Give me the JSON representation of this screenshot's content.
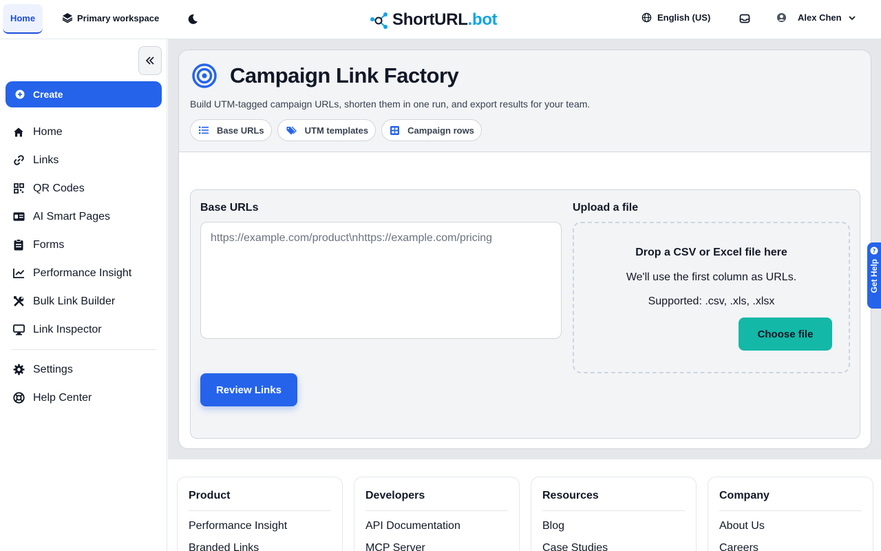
{
  "topbar": {
    "home_tab": "Home",
    "workspace": "Primary workspace",
    "logo_main": "ShortURL",
    "logo_accent": ".bot",
    "language": "English (US)",
    "user_name": "Alex Chen"
  },
  "sidebar": {
    "create_label": "Create",
    "items": [
      {
        "label": "Home",
        "icon": "home-icon"
      },
      {
        "label": "Links",
        "icon": "link-icon"
      },
      {
        "label": "QR Codes",
        "icon": "qr-icon"
      },
      {
        "label": "AI Smart Pages",
        "icon": "id-card-icon"
      },
      {
        "label": "Forms",
        "icon": "clipboard-icon"
      },
      {
        "label": "Performance Insight",
        "icon": "chart-line-icon"
      },
      {
        "label": "Bulk Link Builder",
        "icon": "tools-icon"
      },
      {
        "label": "Link Inspector",
        "icon": "monitor-icon"
      }
    ],
    "secondary": [
      {
        "label": "Settings",
        "icon": "gear-icon"
      },
      {
        "label": "Help Center",
        "icon": "lifebuoy-icon"
      }
    ]
  },
  "page": {
    "title": "Campaign Link Factory",
    "subtitle": "Build UTM-tagged campaign URLs, shorten them in one run, and export results for your team.",
    "pills": [
      {
        "label": "Base URLs",
        "icon": "list-icon"
      },
      {
        "label": "UTM templates",
        "icon": "tag-icon"
      },
      {
        "label": "Campaign rows",
        "icon": "table-icon"
      }
    ]
  },
  "form": {
    "base_urls_label": "Base URLs",
    "base_urls_placeholder": "https://example.com/product\\nhttps://example.com/pricing",
    "review_button": "Review Links",
    "upload_label": "Upload a file",
    "drop_title": "Drop a CSV or Excel file here",
    "drop_hint": "We'll use the first column as URLs.",
    "supported": "Supported: .csv, .xls, .xlsx",
    "choose_button": "Choose file"
  },
  "footer": {
    "columns": [
      {
        "title": "Product",
        "links": [
          "Performance Insight",
          "Branded Links"
        ]
      },
      {
        "title": "Developers",
        "links": [
          "API Documentation",
          "MCP Server"
        ]
      },
      {
        "title": "Resources",
        "links": [
          "Blog",
          "Case Studies"
        ]
      },
      {
        "title": "Company",
        "links": [
          "About Us",
          "Careers"
        ]
      }
    ]
  },
  "get_help": "Get Help",
  "colors": {
    "primary": "#2563eb",
    "teal": "#14b8a6",
    "logo_accent": "#0ea5e9"
  }
}
